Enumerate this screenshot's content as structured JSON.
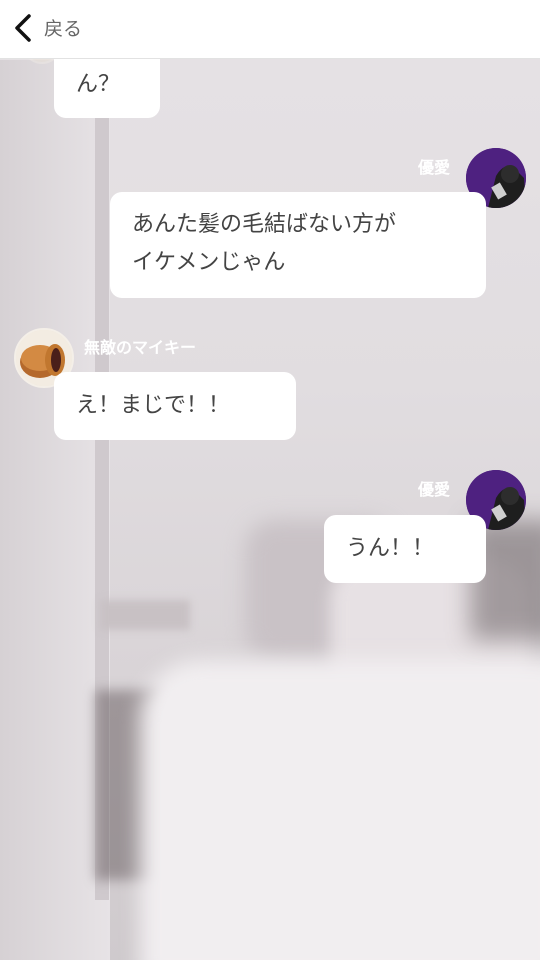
{
  "nav": {
    "back_label": "戻る"
  },
  "messages": [
    {
      "sender": "",
      "text": "ん？",
      "side": "left"
    },
    {
      "sender": "優愛",
      "text_line1": "あんた髪の毛結ばない方が",
      "text_line2": "イケメンじゃん",
      "side": "right"
    },
    {
      "sender": "無敵のマイキー",
      "text": "え！まじで！！",
      "side": "left"
    },
    {
      "sender": "優愛",
      "text": "うん！！",
      "side": "right"
    }
  ],
  "colors": {
    "bubble": "#ffffff",
    "text": "#444444",
    "right_avatar": "#4b1f7a"
  },
  "icons": {
    "back": "chevron-left-icon",
    "left_avatar": "dorayaki-avatar",
    "right_avatar": "purple-avatar"
  }
}
